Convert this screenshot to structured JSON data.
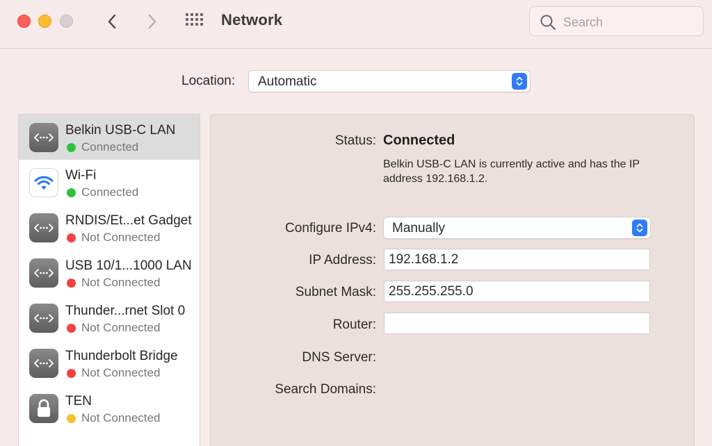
{
  "window": {
    "title": "Network",
    "search_placeholder": "Search"
  },
  "location": {
    "label": "Location:",
    "value": "Automatic"
  },
  "services": [
    {
      "name": "Belkin USB-C LAN",
      "status": "Connected",
      "status_color": "#2fc13f",
      "icon": "ethernet-icon",
      "selected": true
    },
    {
      "name": "Wi-Fi",
      "status": "Connected",
      "status_color": "#2fc13f",
      "icon": "wifi-icon",
      "selected": false
    },
    {
      "name": "RNDIS/Et...et Gadget",
      "status": "Not Connected",
      "status_color": "#f44141",
      "icon": "ethernet-icon",
      "selected": false
    },
    {
      "name": "USB 10/1...1000 LAN",
      "status": "Not Connected",
      "status_color": "#f44141",
      "icon": "ethernet-icon",
      "selected": false
    },
    {
      "name": "Thunder...rnet Slot 0",
      "status": "Not Connected",
      "status_color": "#f44141",
      "icon": "ethernet-icon",
      "selected": false
    },
    {
      "name": "Thunderbolt Bridge",
      "status": "Not Connected",
      "status_color": "#f44141",
      "icon": "ethernet-icon",
      "selected": false
    },
    {
      "name": "TEN",
      "status": "Not Connected",
      "status_color": "#f9be2b",
      "icon": "lock-icon",
      "selected": false
    }
  ],
  "detail": {
    "status_label": "Status:",
    "status_value": "Connected",
    "status_description": "Belkin USB-C LAN is currently active and has the IP address 192.168.1.2.",
    "configure_label": "Configure IPv4:",
    "configure_value": "Manually",
    "ip_label": "IP Address:",
    "ip_value": "192.168.1.2",
    "subnet_label": "Subnet Mask:",
    "subnet_value": "255.255.255.0",
    "router_label": "Router:",
    "router_value": "",
    "dns_label": "DNS Server:",
    "search_domains_label": "Search Domains:"
  },
  "colors": {
    "accent": "#2f7cf6",
    "connected": "#2fc13f",
    "not_connected": "#f44141",
    "warning": "#f9be2b"
  }
}
